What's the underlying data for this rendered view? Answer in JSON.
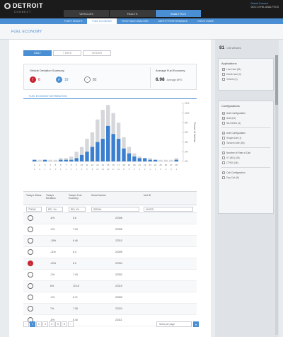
{
  "header": {
    "logo_text": "DETROIT",
    "logo_sub": "CONNECT",
    "tabs": [
      {
        "label": "VEHICLES",
        "active": false
      },
      {
        "label": "FAULTS",
        "active": false
      },
      {
        "label": "ANALYTICS",
        "active": true
      }
    ],
    "user": {
      "name": "Detroit Connect",
      "company": "DDC1 XYNL ANALYTICS"
    }
  },
  "subnav": [
    {
      "label": "FLEET HEALTH",
      "active": false
    },
    {
      "label": "FUEL ECONOMY",
      "active": true
    },
    {
      "label": "FLEET IDLE ANALYSIS",
      "active": false
    },
    {
      "label": "SAFETY PERFORMANCE",
      "active": false
    },
    {
      "label": "DRIVE GUIDE",
      "active": false
    }
  ],
  "page_title": "FUEL ECONOMY",
  "filters": [
    {
      "label": "DAILY",
      "active": true
    },
    {
      "label": "7 DAYS",
      "active": false
    },
    {
      "label": "30 DAYS",
      "active": false
    }
  ],
  "summary": {
    "label": "Vehicle Deviation Summary",
    "stats": [
      {
        "icon": "alert-icon",
        "value": "6",
        "color": "#c8202f"
      },
      {
        "icon": "check-icon",
        "value": "18",
        "color": "#4a8fd4"
      },
      {
        "icon": "neutral-icon",
        "value": "82",
        "color": "#9aa0a6"
      }
    ],
    "avg_label": "Average Fuel Economy",
    "avg_value": "6.98",
    "avg_unit": "Average MPG"
  },
  "distribution_label": "FUEL ECONOMY DISTRIBUTION",
  "chart_data": {
    "type": "bar",
    "categories": [
      "1",
      "2",
      "3",
      "4",
      "5",
      "6",
      "7",
      "8",
      "9",
      "10",
      "11",
      "12",
      "13",
      "14",
      "15",
      "16",
      "17",
      "18",
      "19",
      "20",
      "21",
      "22",
      "23",
      "24",
      "25",
      "26",
      "27",
      "28"
    ],
    "series": [
      {
        "values": [
          1,
          0,
          1,
          0,
          0,
          1,
          1,
          1,
          2,
          4,
          6,
          9,
          12,
          14,
          22,
          17,
          14,
          8,
          5,
          3,
          2,
          2,
          1,
          1,
          0,
          0,
          0,
          1
        ],
        "color": "#3a7fd0"
      },
      {
        "values": [
          1,
          1,
          1,
          1,
          1,
          2,
          2,
          3,
          6,
          9,
          14,
          18,
          26,
          32,
          35,
          30,
          24,
          15,
          9,
          5,
          3,
          2,
          2,
          1,
          1,
          1,
          1,
          2
        ],
        "color": "#d5d7da"
      }
    ],
    "ylim": [
      0,
      36
    ],
    "ylabel_right": "Percent of Vehicles",
    "right_ticks": [
      "12%",
      "10%",
      "8%",
      "6%",
      "4%",
      "2%",
      "0%"
    ]
  },
  "table": {
    "headers": [
      "Today's Status",
      "Today's Deviation",
      "Today's Fuel Economy",
      "Serial Number",
      "Unit ID"
    ],
    "filters": [
      "TODAY",
      "REL 1%",
      "REL 1%",
      "SERIAL",
      "UNITID"
    ],
    "rows": [
      {
        "status": "neutral",
        "deviation": "-8%",
        "economy": "6.6",
        "serial": "22308"
      },
      {
        "status": "neutral",
        "deviation": "-3%",
        "economy": "7.16",
        "serial": "22306"
      },
      {
        "status": "neutral",
        "deviation": "-15%",
        "economy": "6.46",
        "serial": "22310"
      },
      {
        "status": "neutral",
        "deviation": "-11%",
        "economy": "6.4",
        "serial": "22309"
      },
      {
        "status": "alert",
        "deviation": "-20%",
        "economy": "6.0",
        "serial": "22304"
      },
      {
        "status": "neutral",
        "deviation": "-2%",
        "economy": "7.43",
        "serial": "22302"
      },
      {
        "status": "neutral",
        "deviation": "8%",
        "economy": "10.18",
        "serial": "22319"
      },
      {
        "status": "neutral",
        "deviation": "-3%",
        "economy": "6.71",
        "serial": "22303"
      },
      {
        "status": "neutral",
        "deviation": "7%",
        "economy": "7.08",
        "serial": "22324"
      },
      {
        "status": "neutral",
        "deviation": "-8%",
        "economy": "6.40",
        "serial": "22311"
      }
    ]
  },
  "pager": {
    "pages": [
      "1",
      "2",
      "3",
      "4",
      "5",
      "6"
    ],
    "active": "1",
    "per_page": "Items per page"
  },
  "sidebar": {
    "count": "81",
    "count_total": "/ 106 vehicles",
    "applications_title": "Applications",
    "applications": [
      {
        "label": "Line Haul (81)",
        "checked": true
      },
      {
        "label": "Dredk haul (0)",
        "checked": false
      },
      {
        "label": "Vehicle (2)",
        "checked": false
      }
    ],
    "configurations_title": "Configurations",
    "groups": [
      {
        "title": "Axle Configuration",
        "options": [
          {
            "label": "Axle (81)",
            "checked": true
          },
          {
            "label": "NA Others (4)",
            "checked": false
          }
        ]
      },
      {
        "title": "Axle Configuration",
        "options": [
          {
            "label": "Single Axle (1)",
            "checked": false
          },
          {
            "label": "Tandem Axle (80)",
            "checked": false
          }
        ]
      },
      {
        "title": "Number of Rear of Cab",
        "options": [
          {
            "label": "VT (BD) (35)",
            "checked": false
          },
          {
            "label": "CT900 (46)",
            "checked": false
          }
        ]
      },
      {
        "title": "Cab Configuration",
        "options": [
          {
            "label": "Day Cab (8)",
            "checked": false
          }
        ]
      }
    ]
  }
}
